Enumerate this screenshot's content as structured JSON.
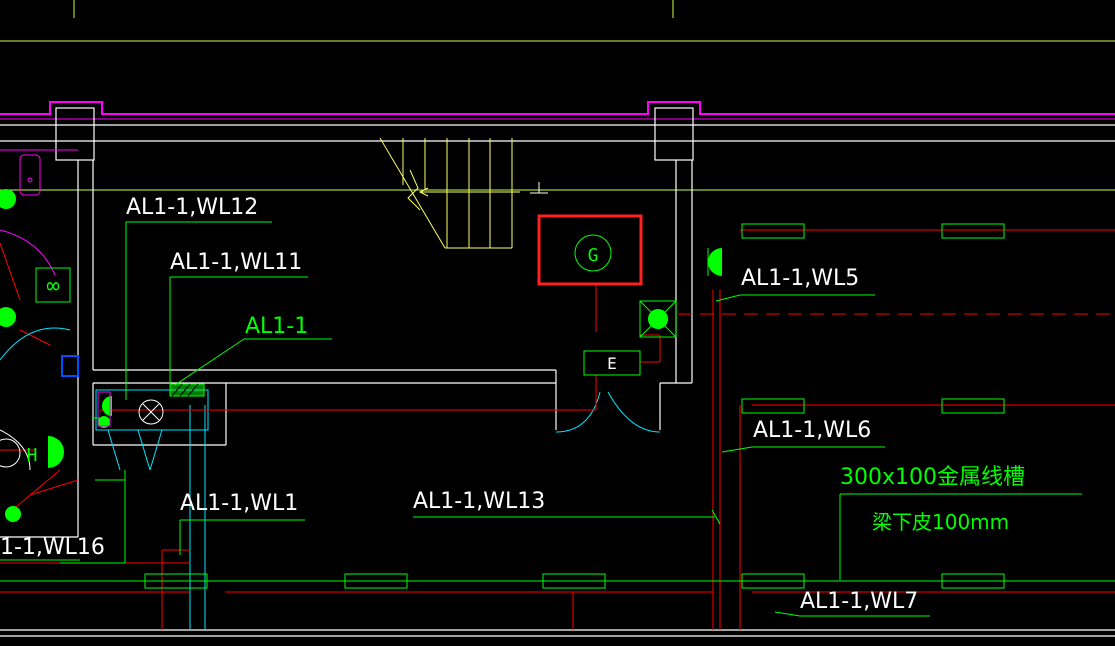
{
  "drawing": {
    "panel_label": "AL1-1",
    "circuit_labels": {
      "wl12": "AL1-1,WL12",
      "wl11": "AL1-1,WL11",
      "wl5": "AL1-1,WL5",
      "wl6": "AL1-1,WL6",
      "wl13": "AL1-1,WL13",
      "wl1": "AL1-1,WL1",
      "wl16": "1-1,WL16",
      "wl7": "AL1-1,WL7"
    },
    "tray_spec_line1": "300x100金属线槽",
    "tray_spec_line2": "梁下皮100mm",
    "generator_symbol": "G",
    "box_symbol": "E",
    "h_symbol": "H",
    "fan_symbol": "∞"
  },
  "colors": {
    "background": "#000000",
    "wall": "#ffffff",
    "axis": "#c8ff40",
    "circuit": "#00ff00",
    "red": "#ff0000",
    "magenta": "#ff00ff",
    "cyan": "#00e5ff",
    "yellow": "#ffff66",
    "highlight_box": "#ff2020",
    "blue": "#0050ff"
  }
}
